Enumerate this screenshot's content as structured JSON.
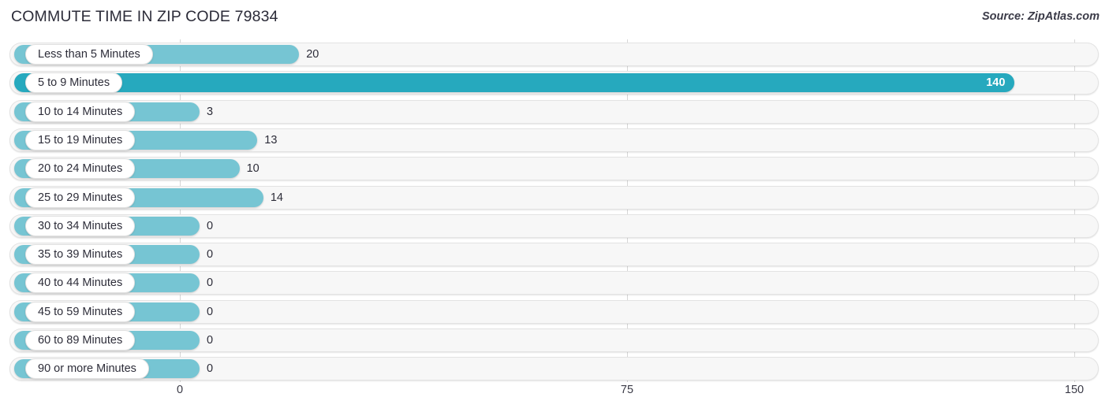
{
  "header": {
    "title": "COMMUTE TIME IN ZIP CODE 79834",
    "source": "Source: ZipAtlas.com"
  },
  "chart_data": {
    "type": "bar",
    "orientation": "horizontal",
    "title": "COMMUTE TIME IN ZIP CODE 79834",
    "xlabel": "",
    "ylabel": "",
    "xlim": [
      0,
      150
    ],
    "xticks": [
      "0",
      "75",
      "150"
    ],
    "xtick_values": [
      0,
      75,
      150
    ],
    "grid": true,
    "legend": false,
    "categories": [
      "Less than 5 Minutes",
      "5 to 9 Minutes",
      "10 to 14 Minutes",
      "15 to 19 Minutes",
      "20 to 24 Minutes",
      "25 to 29 Minutes",
      "30 to 34 Minutes",
      "35 to 39 Minutes",
      "40 to 44 Minutes",
      "45 to 59 Minutes",
      "60 to 89 Minutes",
      "90 or more Minutes"
    ],
    "values": [
      20,
      140,
      3,
      13,
      10,
      14,
      0,
      0,
      0,
      0,
      0,
      0
    ],
    "value_labels": [
      "20",
      "140",
      "3",
      "13",
      "10",
      "14",
      "0",
      "0",
      "0",
      "0",
      "0",
      "0"
    ],
    "highlight_index": 1,
    "colors": {
      "bar": "#76c5d3",
      "bar_highlight": "#26a9be",
      "track": "#f7f7f7",
      "track_border": "#e3e3e3",
      "gridline": "#d7d7d7",
      "text": "#2d2d39",
      "value_inside": "#ffffff"
    }
  }
}
